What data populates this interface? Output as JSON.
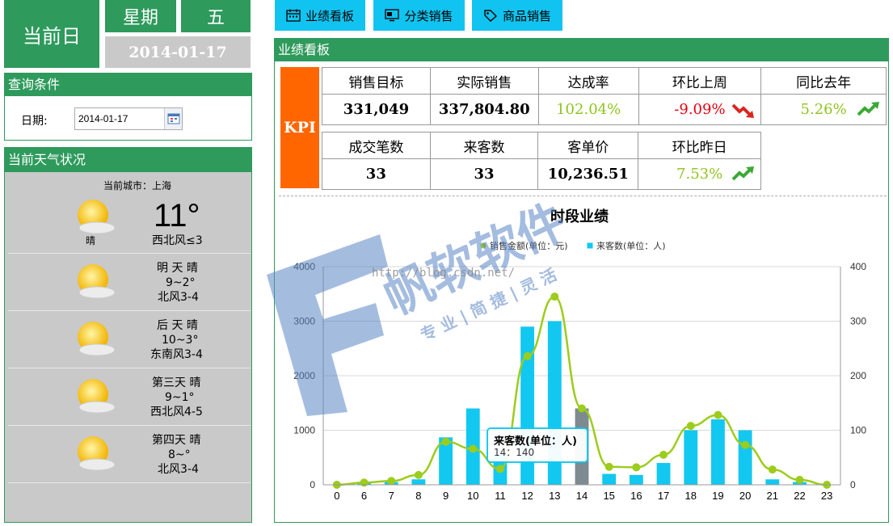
{
  "header": {
    "current_day_label": "当前日",
    "weekday_label": "星期",
    "weekday_value": "五",
    "date_value": "2014-01-17"
  },
  "tabs": [
    {
      "label": "业绩看板",
      "icon": "calendar-icon"
    },
    {
      "label": "分类销售",
      "icon": "monitor-icon"
    },
    {
      "label": "商品销售",
      "icon": "tag-icon"
    }
  ],
  "query": {
    "title": "查询条件",
    "date_label": "日期:",
    "date_value": "2014-01-17"
  },
  "weather": {
    "title": "当前天气状况",
    "city_label": "当前城市：上海",
    "today": {
      "temp": "11°",
      "desc": "晴",
      "wind": "西北风≤3"
    },
    "forecast": [
      {
        "day": "明 天 晴",
        "temp": "9~2°",
        "wind": "北风3-4"
      },
      {
        "day": "后 天 晴",
        "temp": "10~3°",
        "wind": "东南风3-4"
      },
      {
        "day": "第三天 晴",
        "temp": "9~1°",
        "wind": "西北风4-5"
      },
      {
        "day": "第四天 晴",
        "temp": "8~°",
        "wind": "北风3-4"
      }
    ]
  },
  "dashboard": {
    "title": "业绩看板",
    "kpi_label": "KPI",
    "row1_headers": [
      "销售目标",
      "实际销售",
      "达成率",
      "环比上周",
      "同比去年"
    ],
    "row1_values": [
      "331,049",
      "337,804.80",
      "102.04%",
      "-9.09%",
      "5.26%"
    ],
    "row2_headers": [
      "成交笔数",
      "来客数",
      "客单价",
      "环比昨日"
    ],
    "row2_values": [
      "33",
      "33",
      "10,236.51",
      "7.53%"
    ],
    "trend_icons": {
      "down": "trend-down-icon",
      "up": "trend-up-icon"
    },
    "colors": {
      "positive": "#8fc31f",
      "negative": "#e60012",
      "accent": "#2e9a5c",
      "kpi_bg": "#ff6600"
    }
  },
  "watermark": {
    "brand": "帆软软件",
    "slogan": "专 业 | 简 捷 | 灵 活",
    "url": "http://blog.csdn.net/"
  },
  "chart_data": {
    "type": "bar",
    "title": "时段业绩",
    "categories": [
      "0",
      "6",
      "7",
      "8",
      "9",
      "10",
      "11",
      "12",
      "13",
      "14",
      "15",
      "16",
      "17",
      "18",
      "19",
      "20",
      "21",
      "22",
      "23"
    ],
    "series": [
      {
        "name": "销售金额(单位：元)",
        "type": "line",
        "axis": "left",
        "color": "#9ccc1c",
        "values": [
          0,
          40,
          70,
          180,
          790,
          660,
          290,
          2360,
          3450,
          1400,
          330,
          320,
          550,
          1080,
          1280,
          730,
          280,
          90,
          0
        ]
      },
      {
        "name": "来客数(单位：人)",
        "type": "bar",
        "axis": "right",
        "color": "#12c8f0",
        "values": [
          0,
          5,
          5,
          10,
          87,
          140,
          60,
          290,
          300,
          140,
          20,
          18,
          40,
          100,
          120,
          100,
          10,
          5,
          0
        ]
      }
    ],
    "ylim_left": [
      0,
      4000
    ],
    "ylim_right": [
      0,
      400
    ],
    "yticks_left": [
      "0",
      "1000",
      "2000",
      "3000",
      "4000"
    ],
    "yticks_right": [
      "0",
      "100",
      "200",
      "300",
      "400"
    ],
    "legend_position": "top-center",
    "grid": true,
    "tooltip": {
      "title": "来客数(单位：人)",
      "text": "14：140"
    }
  }
}
